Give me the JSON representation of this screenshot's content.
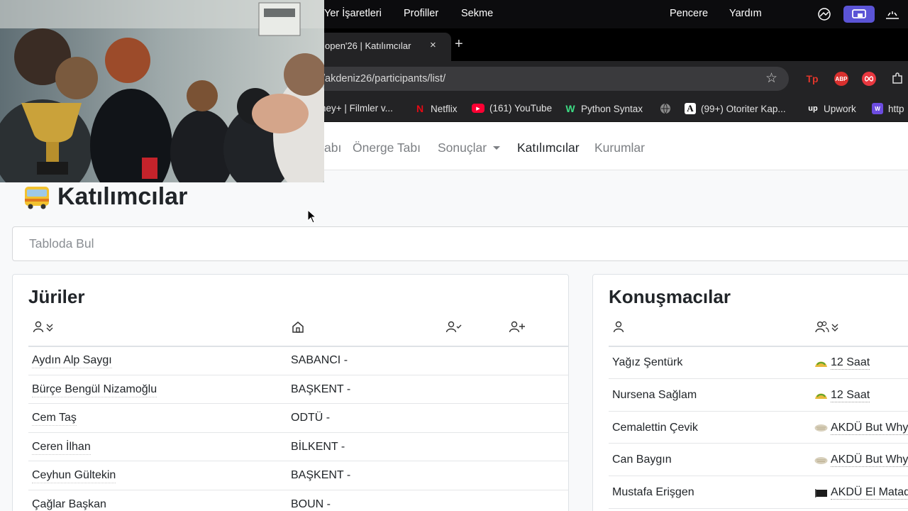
{
  "menubar": {
    "items": [
      "Yer İşaretleri",
      "Profiller",
      "Sekme",
      "Pencere",
      "Yardım"
    ]
  },
  "browser": {
    "tab_title": "open'26 | Katılımcılar",
    "tab_close": "×",
    "new_tab": "+",
    "url": "/akdeniz26/participants/list/",
    "extensions": [
      "Tp",
      "ABP"
    ]
  },
  "bookmarks": [
    {
      "label": "ney+ | Filmler v...",
      "icon": ""
    },
    {
      "label": "Netflix",
      "icon": "netflix-icon"
    },
    {
      "label": "(161) YouTube",
      "icon": "youtube-icon"
    },
    {
      "label": "Python Syntax",
      "icon": "w-icon"
    },
    {
      "label": "",
      "icon": "globe-icon"
    },
    {
      "label": "(99+) Otoriter Kap...",
      "icon": "a-icon"
    },
    {
      "label": "Upwork",
      "icon": "upwork-icon"
    },
    {
      "label": "http",
      "icon": "web-icon"
    }
  ],
  "nav": {
    "partial": "abı",
    "motion_tab": "Önerge Tabı",
    "results": "Sonuçlar",
    "participants": "Katılımcılar",
    "institutions": "Kurumlar"
  },
  "page": {
    "title": "Katılımcılar",
    "search_placeholder": "Tabloda Bul"
  },
  "juri": {
    "title": "Jüriler",
    "rows": [
      {
        "name": "Aydın Alp Saygı",
        "institution": "SABANCI -"
      },
      {
        "name": "Bürçe Bengül Nizamoğlu",
        "institution": "BAŞKENT -"
      },
      {
        "name": "Cem Taş",
        "institution": "ODTÜ -"
      },
      {
        "name": "Ceren İlhan",
        "institution": "BİLKENT -"
      },
      {
        "name": "Ceyhun Gültekin",
        "institution": "BAŞKENT -"
      },
      {
        "name": "Çağlar Başkan",
        "institution": "BOUN -"
      }
    ]
  },
  "konusmacilar": {
    "title": "Konuşmacılar",
    "rows": [
      {
        "name": "Yağız Şentürk",
        "team": "12 Saat",
        "team_icon": "taco-icon"
      },
      {
        "name": "Nursena Sağlam",
        "team": "12 Saat",
        "team_icon": "taco-icon"
      },
      {
        "name": "Cemalettin Çevik",
        "team": "AKDÜ But Why",
        "team_icon": "flatbread-icon"
      },
      {
        "name": "Can Baygın",
        "team": "AKDÜ But Why",
        "team_icon": "flatbread-icon"
      },
      {
        "name": "Mustafa Erişgen",
        "team": "AKDÜ El Matad",
        "team_icon": "black-flag-icon"
      }
    ]
  },
  "colors": {
    "menubar": "#0c0c0e",
    "browser_chrome": "#232325",
    "page_bg": "#f8f9fa",
    "cast_button": "#5b54d6"
  }
}
